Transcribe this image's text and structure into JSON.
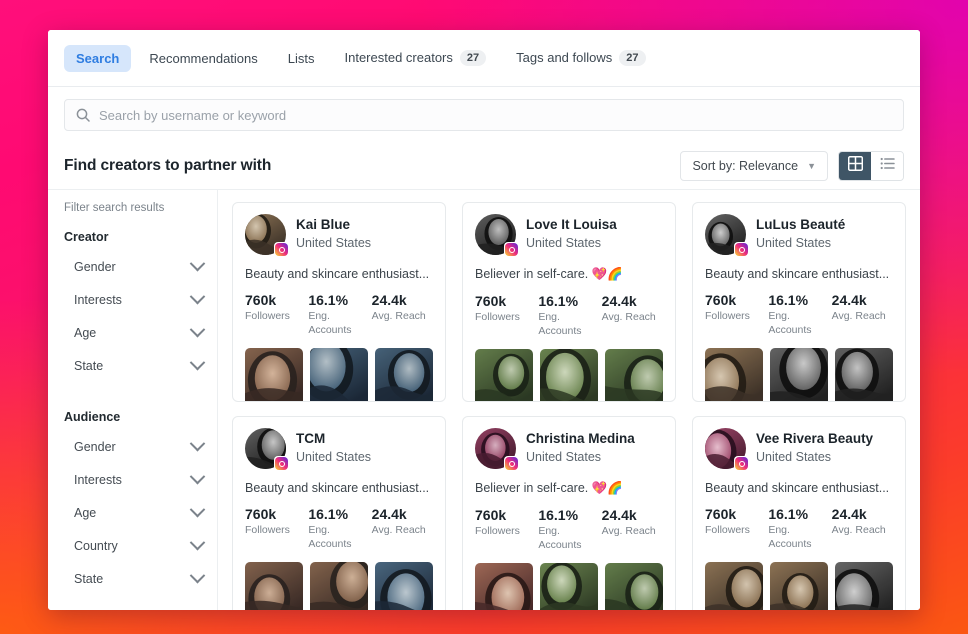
{
  "tabs": [
    {
      "label": "Search",
      "badge": null,
      "active": true
    },
    {
      "label": "Recommendations",
      "badge": null,
      "active": false
    },
    {
      "label": "Lists",
      "badge": null,
      "active": false
    },
    {
      "label": "Interested creators",
      "badge": "27",
      "active": false
    },
    {
      "label": "Tags and follows",
      "badge": "27",
      "active": false
    }
  ],
  "search": {
    "placeholder": "Search by username or keyword",
    "value": "",
    "icon": "search-icon"
  },
  "header": {
    "title": "Find creators to partner with",
    "sort_label": "Sort by: Relevance",
    "sort_caret": "▼",
    "view_grid_icon": "grid-view-icon",
    "view_list_icon": "list-view-icon",
    "active_view": "grid"
  },
  "sidebar": {
    "heading": "Filter search results",
    "groups": [
      {
        "title": "Creator",
        "items": [
          {
            "label": "Gender"
          },
          {
            "label": "Interests"
          },
          {
            "label": "Age"
          },
          {
            "label": "State"
          }
        ]
      },
      {
        "title": "Audience",
        "items": [
          {
            "label": "Gender"
          },
          {
            "label": "Interests"
          },
          {
            "label": "Age"
          },
          {
            "label": "Country"
          },
          {
            "label": "State"
          }
        ]
      }
    ]
  },
  "stat_labels": {
    "followers": "Followers",
    "engagement": "Eng. Accounts",
    "reach": "Avg. Reach"
  },
  "creators": [
    {
      "name": "Kai Blue",
      "location": "United States",
      "bio": "Beauty and skincare enthusiast...",
      "followers": "760k",
      "engagement": "16.1%",
      "reach": "24.4k",
      "platform": "instagram"
    },
    {
      "name": "Love It Louisa",
      "location": "United States",
      "bio": "Believer in self-care. 💖🌈",
      "followers": "760k",
      "engagement": "16.1%",
      "reach": "24.4k",
      "platform": "instagram"
    },
    {
      "name": "LuLus Beauté",
      "location": "United States",
      "bio": "Beauty and skincare enthusiast...",
      "followers": "760k",
      "engagement": "16.1%",
      "reach": "24.4k",
      "platform": "instagram"
    },
    {
      "name": "TCM",
      "location": "United States",
      "bio": "Beauty and skincare enthusiast...",
      "followers": "760k",
      "engagement": "16.1%",
      "reach": "24.4k",
      "platform": "instagram"
    },
    {
      "name": "Christina Medina",
      "location": "United States",
      "bio": "Believer in self-care. 💖🌈",
      "followers": "760k",
      "engagement": "16.1%",
      "reach": "24.4k",
      "platform": "instagram"
    },
    {
      "name": "Vee Rivera Beauty",
      "location": "United States",
      "bio": "Beauty and skincare enthusiast...",
      "followers": "760k",
      "engagement": "16.1%",
      "reach": "24.4k",
      "platform": "instagram"
    }
  ],
  "colors": {
    "accent_blue": "#2f7de1",
    "active_tab_bg": "#d6e6fb",
    "toggle_active": "#3f5566",
    "page_bg_top": "#FF0F7B",
    "page_bg_bottom": "#FB5712"
  }
}
